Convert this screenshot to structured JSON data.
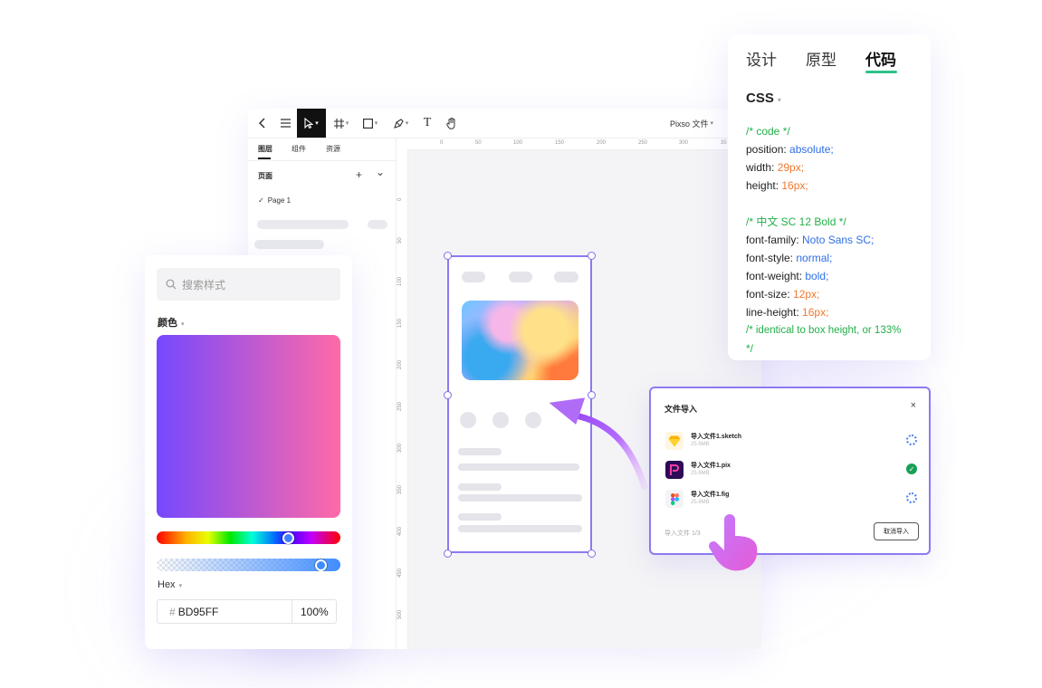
{
  "toolbar": {
    "back_icon": "chevron-left-icon",
    "menu_icon": "menu-icon",
    "select_icon": "cursor-icon",
    "frame_icon": "frame-icon",
    "rect_icon": "rectangle-icon",
    "pen_icon": "pen-icon",
    "text_label": "T",
    "hand_icon": "hand-icon",
    "file_menu": "Pixso 文件"
  },
  "left_panel": {
    "tabs": [
      "图层",
      "组件",
      "资源"
    ],
    "pages_label": "页面",
    "add_icon": "+",
    "collapse_icon": "⌄",
    "page_item": "Page 1"
  },
  "rulers": {
    "top": [
      "0",
      "50",
      "100",
      "150",
      "200",
      "250",
      "300",
      "35"
    ],
    "left": [
      "0",
      "50",
      "100",
      "150",
      "200",
      "250",
      "300",
      "350",
      "400",
      "450",
      "500",
      "550"
    ]
  },
  "style_panel": {
    "search_placeholder": "搜索样式",
    "color_label": "颜色",
    "hex_label": "Hex",
    "hex_value": "BD95FF",
    "opacity": "100%",
    "gradient_start": "#7648ff",
    "gradient_end": "#ff6aa7",
    "hue_position": 0.73,
    "alpha_position": 0.92
  },
  "code_panel": {
    "tabs": [
      "设计",
      "原型",
      "代码"
    ],
    "selected_tab": "代码",
    "accent": "#2ec28a",
    "language": "CSS"
  },
  "import_dialog": {
    "title": "文件导入",
    "close": "×",
    "files": [
      {
        "name": "导入文件1.sketch",
        "size": "25.6MB",
        "status": "loading",
        "icon": "sketch-icon"
      },
      {
        "name": "导入文件1.pix",
        "size": "25.6MB",
        "status": "done",
        "icon": "pixso-icon"
      },
      {
        "name": "导入文件1.fig",
        "size": "25.6MB",
        "status": "loading",
        "icon": "figma-icon"
      }
    ],
    "progress": "导入文件  1/3",
    "cancel": "取消导入"
  },
  "decor": {
    "arrow_icon": "curved-arrow-icon",
    "pointer_icon": "hand-pointer-icon",
    "accent": "#b36bff"
  }
}
